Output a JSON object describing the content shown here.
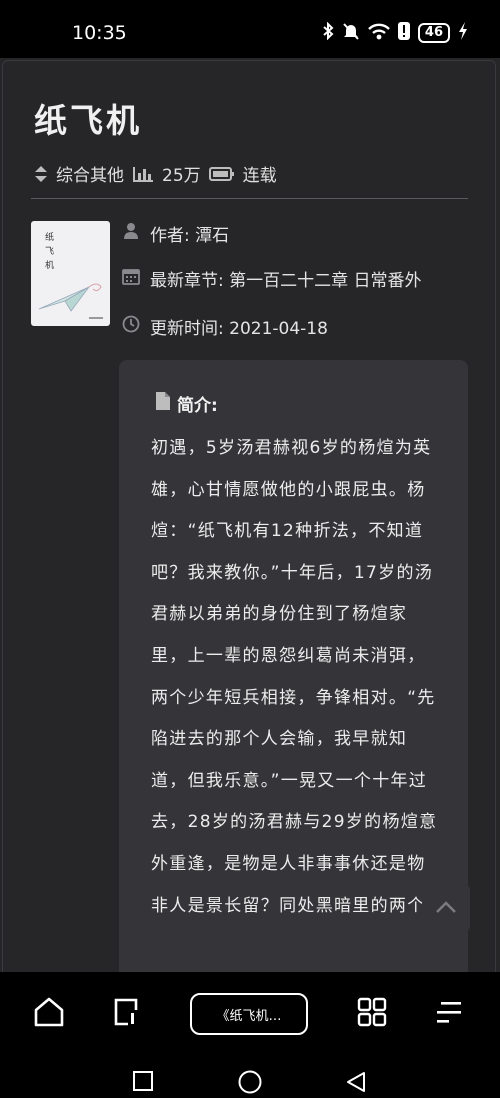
{
  "status": {
    "time": "10:35",
    "battery": "46"
  },
  "book": {
    "title": "纸飞机",
    "category": "综合其他",
    "word_count": "25万",
    "status": "连载",
    "cover_title": "纸飞机",
    "author_label": "作者: 潭石",
    "latest_label": "最新章节: 第一百二十二章 日常番外",
    "updated_label": "更新时间: 2021-04-18"
  },
  "intro": {
    "heading": "简介:",
    "text": "初遇，5岁汤君赫视6岁的杨煊为英雄，心甘情愿做他的小跟屁虫。杨煊：“纸飞机有12种折法，不知道吧？我来教你。”十年后，17岁的汤君赫以弟弟的身份住到了杨煊家里，上一辈的恩怨纠葛尚未消弭，两个少年短兵相接，争锋相对。“先陷进去的那个人会输，我早就知道，但我乐意。”一晃又一个十年过去，28岁的汤君赫与29岁的杨煊意外重逢，是物是人非事事休还是物非人是景长留？同处黑暗里的两个"
  },
  "bottom_nav": {
    "current_book": "《纸飞机…"
  }
}
